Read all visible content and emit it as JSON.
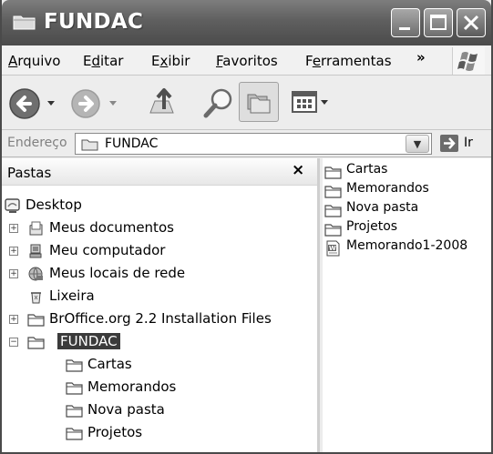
{
  "window": {
    "title": "FUNDAC"
  },
  "menu": [
    {
      "label": "Arquivo",
      "mnemonic_index": 0
    },
    {
      "label": "Editar",
      "mnemonic_index": 1
    },
    {
      "label": "Exibir",
      "mnemonic_index": 1
    },
    {
      "label": "Favoritos",
      "mnemonic_index": 0
    },
    {
      "label": "Ferramentas",
      "mnemonic_index": 1
    }
  ],
  "menu_overflow": "»",
  "toolbar": {
    "back_icon": "back-arrow-icon",
    "forward_icon": "forward-arrow-icon",
    "up_icon": "up-folder-icon",
    "search_icon": "search-icon",
    "folders_icon": "folders-icon",
    "views_icon": "views-icon"
  },
  "address": {
    "label": "Endereço",
    "value": "FUNDAC",
    "go_label": "Ir"
  },
  "folders_pane": {
    "title": "Pastas",
    "close": "×",
    "tree": [
      {
        "label": "Desktop",
        "icon": "desktop-icon",
        "expander": ""
      },
      {
        "label": "Meus documentos",
        "icon": "documents-icon",
        "expander": "+"
      },
      {
        "label": "Meu computador",
        "icon": "computer-icon",
        "expander": "+"
      },
      {
        "label": "Meus locais de rede",
        "icon": "network-icon",
        "expander": "+"
      },
      {
        "label": "Lixeira",
        "icon": "recycle-bin-icon",
        "expander": ""
      },
      {
        "label": "BrOffice.org 2.2 Installation Files",
        "icon": "folder-icon",
        "expander": "+"
      },
      {
        "label": "FUNDAC",
        "icon": "folder-open-icon",
        "expander": "−",
        "selected": true
      },
      {
        "label": "Cartas",
        "icon": "folder-icon",
        "expander": ""
      },
      {
        "label": "Memorandos",
        "icon": "folder-icon",
        "expander": ""
      },
      {
        "label": "Nova pasta",
        "icon": "folder-icon",
        "expander": ""
      },
      {
        "label": "Projetos",
        "icon": "folder-icon",
        "expander": ""
      }
    ]
  },
  "content": {
    "items": [
      {
        "label": "Cartas",
        "icon": "folder-icon"
      },
      {
        "label": "Memorandos",
        "icon": "folder-icon"
      },
      {
        "label": "Nova pasta",
        "icon": "folder-icon"
      },
      {
        "label": "Projetos",
        "icon": "folder-icon"
      },
      {
        "label": "Memorando1-2008",
        "icon": "word-document-icon"
      }
    ]
  }
}
